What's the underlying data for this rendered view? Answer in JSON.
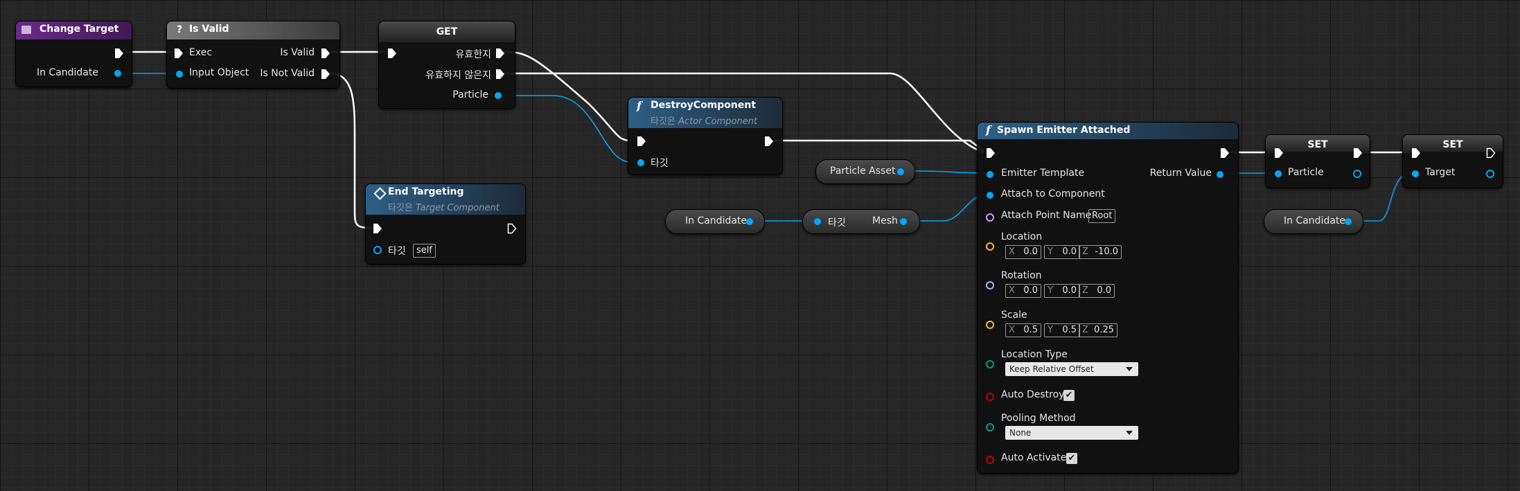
{
  "colors": {
    "exec": "#ffffff",
    "object": "#00a8f4",
    "name": "#c8a0ff",
    "vector": "#ffb82e",
    "rotator": "#a0b4ff",
    "enum": "#009a8a",
    "bool": "#c00000"
  },
  "change_target": {
    "title": "Change Target",
    "pin_in_candidate": "In Candidate"
  },
  "is_valid": {
    "title": "Is Valid",
    "exec": "Exec",
    "input_object": "Input Object",
    "is_valid": "Is Valid",
    "is_not_valid": "Is Not Valid"
  },
  "get_node": {
    "title": "GET",
    "valid": "유효한지",
    "not_valid": "유효하지 않은지",
    "particle": "Particle"
  },
  "destroy": {
    "title": "DestroyComponent",
    "sub_prefix": "타깃은",
    "sub_type": "Actor Component",
    "target": "타깃"
  },
  "end_targeting": {
    "title": "End Targeting",
    "sub_prefix": "타깃은",
    "sub_type": "Target Component",
    "target": "타깃",
    "target_value": "self"
  },
  "particle_asset": "Particle Asset",
  "in_candidate_getter": "In Candidate",
  "mesh_getter": {
    "target": "타깃",
    "mesh": "Mesh"
  },
  "spawn": {
    "title": "Spawn Emitter Attached",
    "emitter_template": "Emitter Template",
    "attach_to_component": "Attach to Component",
    "attach_point_name": "Attach Point Name",
    "attach_point_value": "Root",
    "return_value": "Return Value",
    "location": {
      "label": "Location",
      "x": "0.0",
      "y": "0.0",
      "z": "-10.0"
    },
    "rotation": {
      "label": "Rotation",
      "x": "0.0",
      "y": "0.0",
      "z": "0.0"
    },
    "scale": {
      "label": "Scale",
      "x": "0.5",
      "y": "0.5",
      "z": "0.25"
    },
    "axis_x": "X",
    "axis_y": "Y",
    "axis_z": "Z",
    "location_type": {
      "label": "Location Type",
      "value": "Keep Relative Offset"
    },
    "auto_destroy": {
      "label": "Auto Destroy",
      "checked": true
    },
    "pooling_method": {
      "label": "Pooling Method",
      "value": "None"
    },
    "auto_activate": {
      "label": "Auto Activate",
      "checked": true
    }
  },
  "set1": {
    "title": "SET",
    "particle": "Particle"
  },
  "set2": {
    "title": "SET",
    "target": "Target"
  },
  "in_candidate_getter2": "In Candidate",
  "checkmark": "✔"
}
